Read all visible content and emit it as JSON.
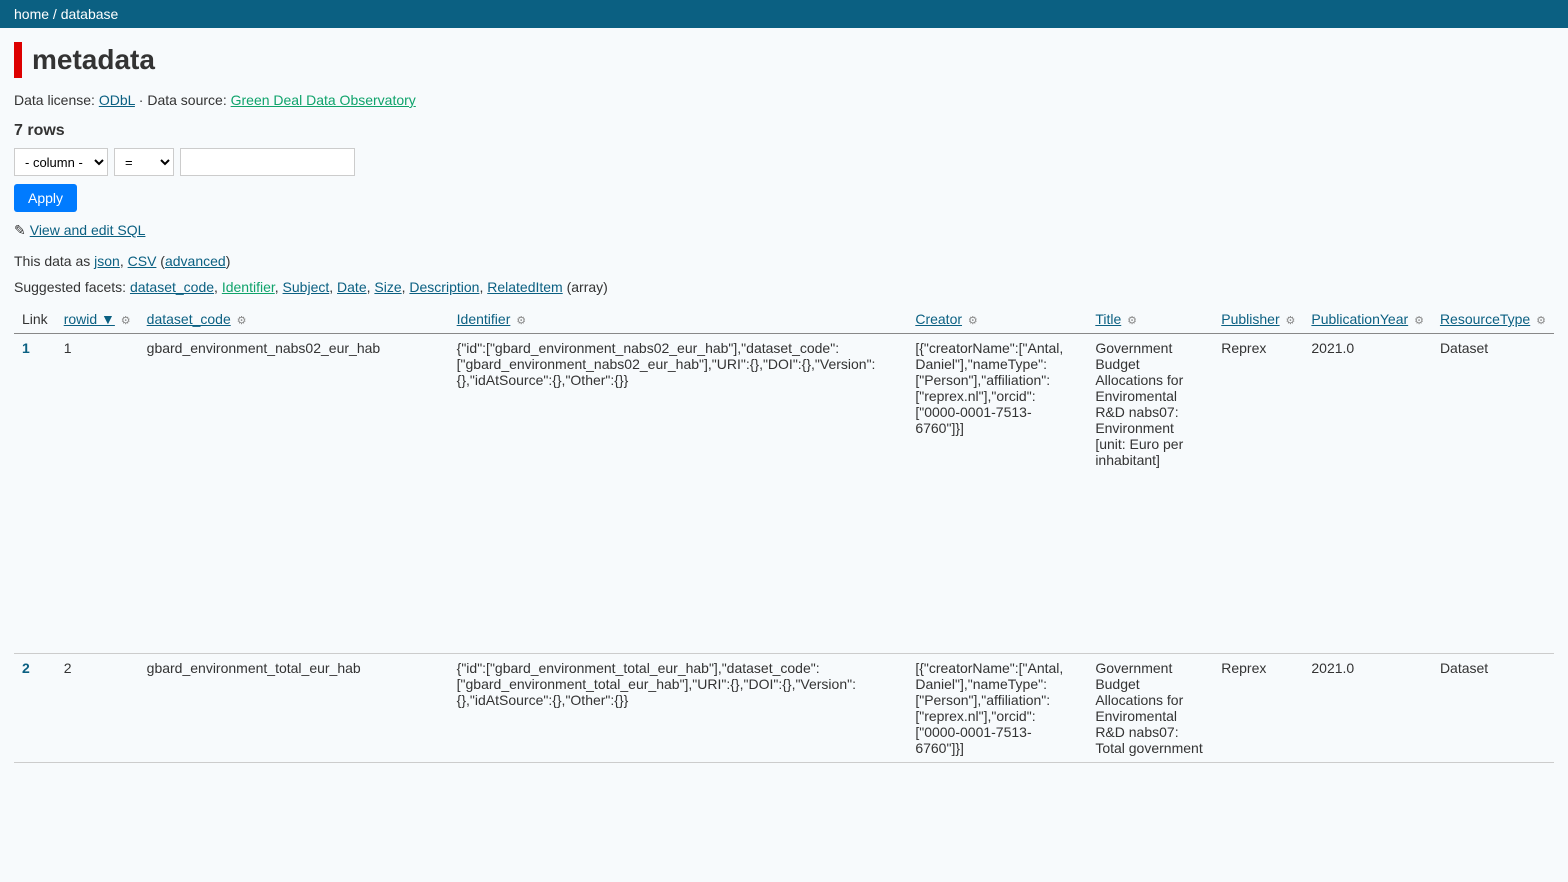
{
  "breadcrumb": {
    "home": "home",
    "sep": " / ",
    "db": "database"
  },
  "title": "metadata",
  "license": {
    "label": "Data license: ",
    "link": "ODbL",
    "sep": " · ",
    "source_label": "Data source: ",
    "source_link": "Green Deal Data Observatory"
  },
  "rows_count": "7 rows",
  "filter": {
    "column_placeholder": "- column -",
    "op_placeholder": "=",
    "apply": "Apply"
  },
  "sql": {
    "pencil": "✎",
    "link": "View and edit SQL"
  },
  "export": {
    "prefix": "This data as ",
    "json": "json",
    "csv": "CSV",
    "open": " (",
    "advanced": "advanced",
    "close": ")"
  },
  "facets": {
    "prefix": "Suggested facets: ",
    "items": [
      "dataset_code",
      "Identifier",
      "Subject",
      "Date",
      "Size",
      "Description",
      "RelatedItem"
    ],
    "suffix": " (array)"
  },
  "columns": {
    "link": "Link",
    "rowid": "rowid ▼",
    "dataset_code": "dataset_code",
    "identifier": "Identifier",
    "creator": "Creator",
    "title": "Title",
    "publisher": "Publisher",
    "publication_year": "PublicationYear",
    "resource_type": "ResourceType"
  },
  "gear": "⚙",
  "rows": [
    {
      "link": "1",
      "rowid": "1",
      "dataset_code": "gbard_environment_nabs02_eur_hab",
      "identifier": "{\"id\":[\"gbard_environment_nabs02_eur_hab\"],\"dataset_code\":[\"gbard_environment_nabs02_eur_hab\"],\"URI\":{},\"DOI\":{},\"Version\":{},\"idAtSource\":{},\"Other\":{}}",
      "creator": "[{\"creatorName\":[\"Antal, Daniel\"],\"nameType\":[\"Person\"],\"affiliation\":[\"reprex.nl\"],\"orcid\":[\"0000-0001-7513-6760\"]}]",
      "title": "Government Budget Allocations for Enviromental R&D nabs07: Environment [unit: Euro per inhabitant]",
      "publisher": "Reprex",
      "publication_year": "2021.0",
      "resource_type": "Dataset"
    },
    {
      "link": "2",
      "rowid": "2",
      "dataset_code": "gbard_environment_total_eur_hab",
      "identifier": "{\"id\":[\"gbard_environment_total_eur_hab\"],\"dataset_code\":[\"gbard_environment_total_eur_hab\"],\"URI\":{},\"DOI\":{},\"Version\":{},\"idAtSource\":{},\"Other\":{}}",
      "creator": "[{\"creatorName\":[\"Antal, Daniel\"],\"nameType\":[\"Person\"],\"affiliation\":[\"reprex.nl\"],\"orcid\":[\"0000-0001-7513-6760\"]}]",
      "title": "Government Budget Allocations for Enviromental R&D nabs07: Total government",
      "publisher": "Reprex",
      "publication_year": "2021.0",
      "resource_type": "Dataset"
    }
  ]
}
